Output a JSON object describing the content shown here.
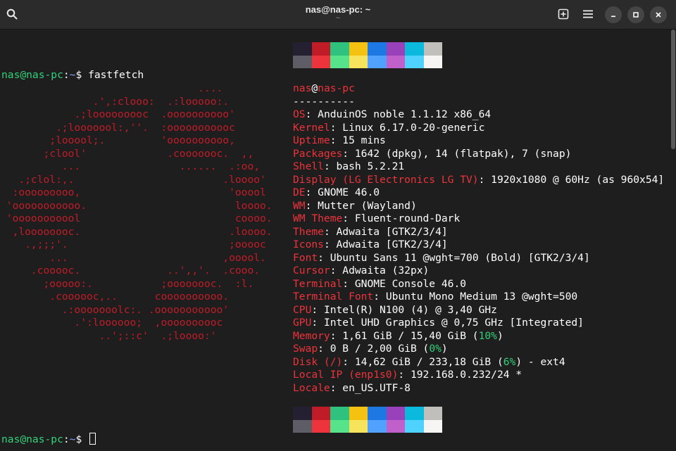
{
  "window": {
    "title": "nas@nas-pc: ~",
    "subtitle": "~",
    "search_icon": "search-icon",
    "new_tab_icon": "new-tab-icon",
    "menu_icon": "hamburger-menu-icon",
    "minimize_icon": "minimize-icon",
    "maximize_icon": "maximize-icon",
    "close_icon": "close-icon"
  },
  "terminal": {
    "prompt_user": "nas@nas-pc",
    "prompt_sep": ":",
    "prompt_path": "~",
    "prompt_symbol": "$",
    "command": "fastfetch",
    "logo_lines": [
      "                                ....",
      "               .',:clooo:  .:looooo:.",
      "            .;looooooooc  .oooooooooo'",
      "         .;looooool:,''.  :ooooooooooc",
      "        ;looool;.         'oooooooooo,",
      "       ;clool'             .cooooooc.  ,,",
      "          ...                ......  .:oo,",
      "   .;clol:,.                        .loooo'",
      "  :ooooooooo,                        'ooool",
      " 'ooooooooooo.                        loooo.",
      " 'ooooooooool                         coooo.",
      "  ,loooooooc.                        .loooo.",
      "    .,;;;'.                          ;ooooc",
      "        ...                         ,ooool.",
      "     .cooooc.              ..',,'.  .cooo.",
      "       ;ooooo:.           ;oooooooc.  :l.",
      "        .coooooc,..      coooooooooo.",
      "          .:ooooooolc:. .ooooooooooo'",
      "            .':loooooo;  ,oooooooooc",
      "                ..';::c'  .;loooo:'"
    ],
    "user": "nas",
    "at": "@",
    "host": "nas-pc",
    "separator": "----------",
    "info": [
      {
        "key": "OS",
        "value": "AnduinOS noble 1.1.12 x86_64"
      },
      {
        "key": "Kernel",
        "value": "Linux 6.17.0-20-generic"
      },
      {
        "key": "Uptime",
        "value": "15 mins"
      },
      {
        "key": "Packages",
        "value": "1642 (dpkg), 14 (flatpak), 7 (snap)"
      },
      {
        "key": "Shell",
        "value": "bash 5.2.21"
      },
      {
        "key": "Display (LG Electronics LG TV)",
        "value": "1920x1080 @ 60Hz (as 960x54]"
      },
      {
        "key": "DE",
        "value": "GNOME 46.0"
      },
      {
        "key": "WM",
        "value": "Mutter (Wayland)"
      },
      {
        "key": "WM Theme",
        "value": "Fluent-round-Dark"
      },
      {
        "key": "Theme",
        "value": "Adwaita [GTK2/3/4]"
      },
      {
        "key": "Icons",
        "value": "Adwaita [GTK2/3/4]"
      },
      {
        "key": "Font",
        "value": "Ubuntu Sans 11 @wght=700 (Bold) [GTK2/3/4]"
      },
      {
        "key": "Cursor",
        "value": "Adwaita (32px)"
      },
      {
        "key": "Terminal",
        "value": "GNOME Console 46.0"
      },
      {
        "key": "Terminal Font",
        "value": "Ubuntu Mono Medium 13 @wght=500"
      },
      {
        "key": "CPU",
        "value": "Intel(R) N100 (4) @ 3,40 GHz"
      },
      {
        "key": "GPU",
        "value": "Intel UHD Graphics @ 0,75 GHz [Integrated]"
      },
      {
        "key": "Memory",
        "value_pre": "1,61 GiB / 15,40 GiB (",
        "value_pct": "10%",
        "value_post": ")"
      },
      {
        "key": "Swap",
        "value_pre": "0 B / 2,00 GiB (",
        "value_pct": "0%",
        "value_post": ")"
      },
      {
        "key": "Disk (/)",
        "value_pre": "14,62 GiB / 233,18 GiB (",
        "value_pct": "6%",
        "value_post": ") - ext4"
      },
      {
        "key": "Local IP (enp1s0)",
        "value": "192.168.0.232/24 *"
      },
      {
        "key": "Locale",
        "value": "en_US.UTF-8"
      }
    ],
    "key_value_sep": ": ",
    "palette_top": [
      "#241f31",
      "#c01c28",
      "#2ec27e",
      "#f5c211",
      "#1e78e4",
      "#9841bb",
      "#0ab9dc",
      "#c0bfbc"
    ],
    "palette_bottom": [
      "#5e5c64",
      "#ed333b",
      "#57e389",
      "#f8e45c",
      "#51a1ff",
      "#c061cb",
      "#4fd2fd",
      "#f6f5f4"
    ]
  },
  "colors": {
    "prompt_green": "#33d17a",
    "path_blue": "#7aa7ff",
    "key_red": "#ed333b",
    "logo_red": "#c01c28",
    "pct_green": "#33d17a"
  }
}
